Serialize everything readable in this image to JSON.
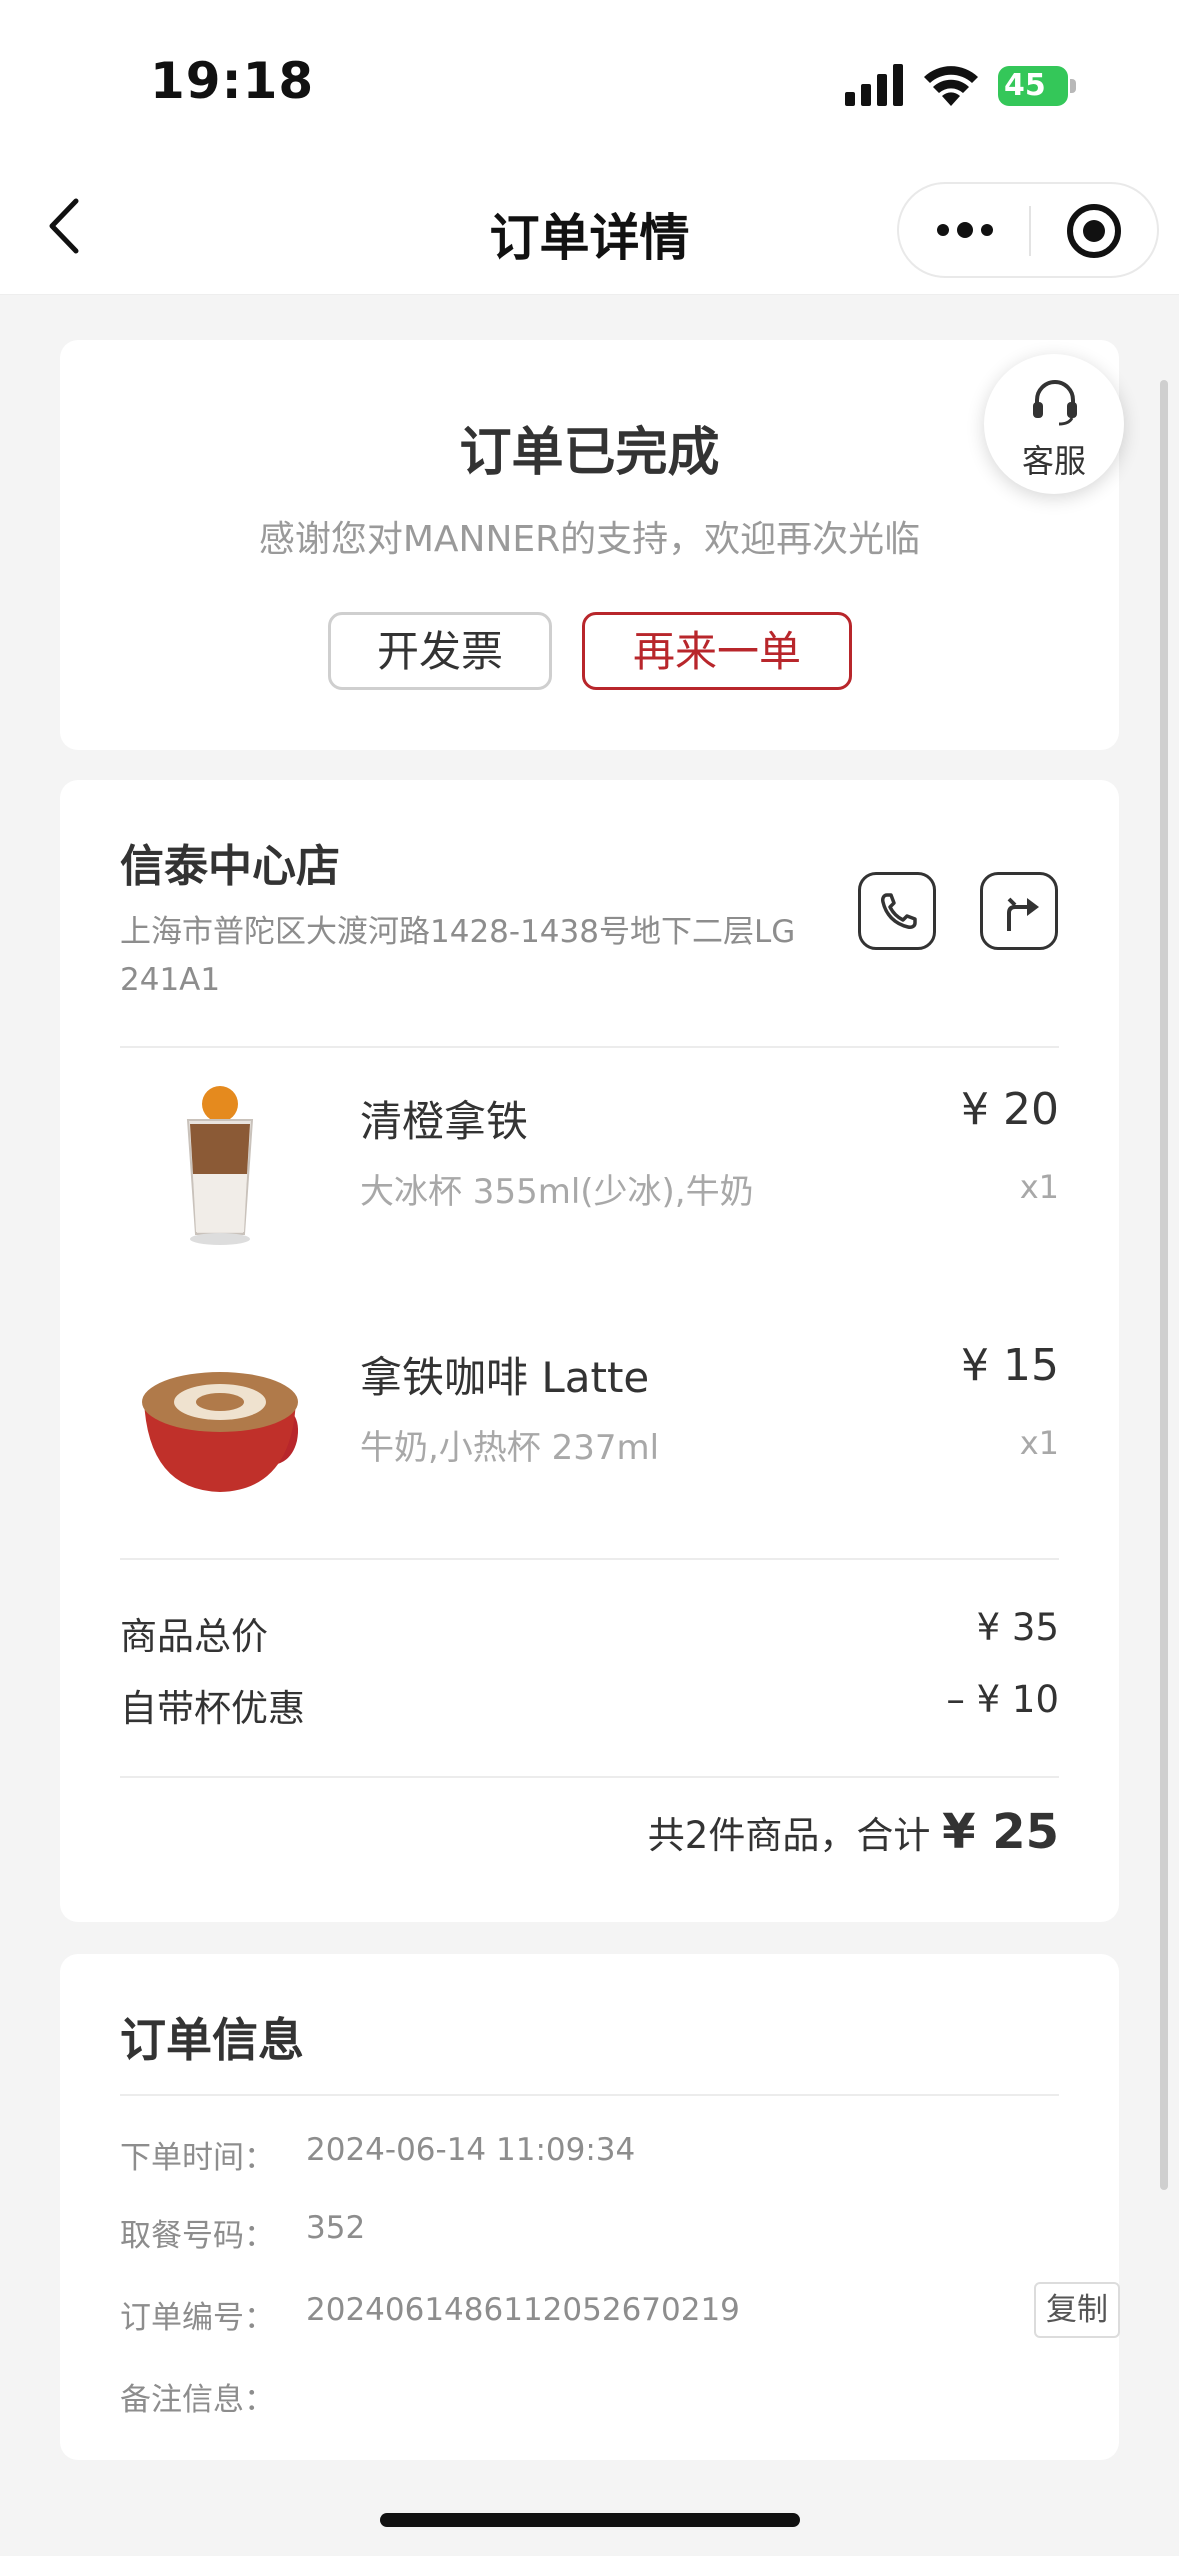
{
  "status_bar": {
    "time": "19:18",
    "battery": "45"
  },
  "nav": {
    "title": "订单详情"
  },
  "status_card": {
    "title": "订单已完成",
    "message": "感谢您对MANNER的支持，欢迎再次光临",
    "invoice_label": "开发票",
    "reorder_label": "再来一单"
  },
  "service": {
    "label": "客服"
  },
  "store": {
    "name": "信泰中心店",
    "address": "上海市普陀区大渡河路1428-1438号地下二层LG 241A1"
  },
  "items": [
    {
      "name": "清橙拿铁",
      "spec": "大冰杯 355ml(少冰),牛奶",
      "price": "¥ 20",
      "qty": "x1"
    },
    {
      "name": "拿铁咖啡 Latte",
      "spec": "牛奶,小热杯 237ml",
      "price": "¥ 15",
      "qty": "x1"
    }
  ],
  "summary": {
    "subtotal_label": "商品总价",
    "subtotal_value": "¥ 35",
    "discount_label": "自带杯优惠",
    "discount_value": "– ¥ 10",
    "total_prefix": "共2件商品，合计 ",
    "total_amount": "¥ 25"
  },
  "order_info": {
    "title": "订单信息",
    "time_label": "下单时间：",
    "time_value": "2024-06-14 11:09:34",
    "pickup_label": "取餐号码：",
    "pickup_value": "352",
    "order_no_label": "订单编号：",
    "order_no_value": "2024061486112052670219",
    "copy_label": "复制",
    "note_label": "备注信息："
  },
  "colors": {
    "accent": "#b8262b",
    "battery": "#34c759",
    "muted": "#8d8d8d"
  }
}
